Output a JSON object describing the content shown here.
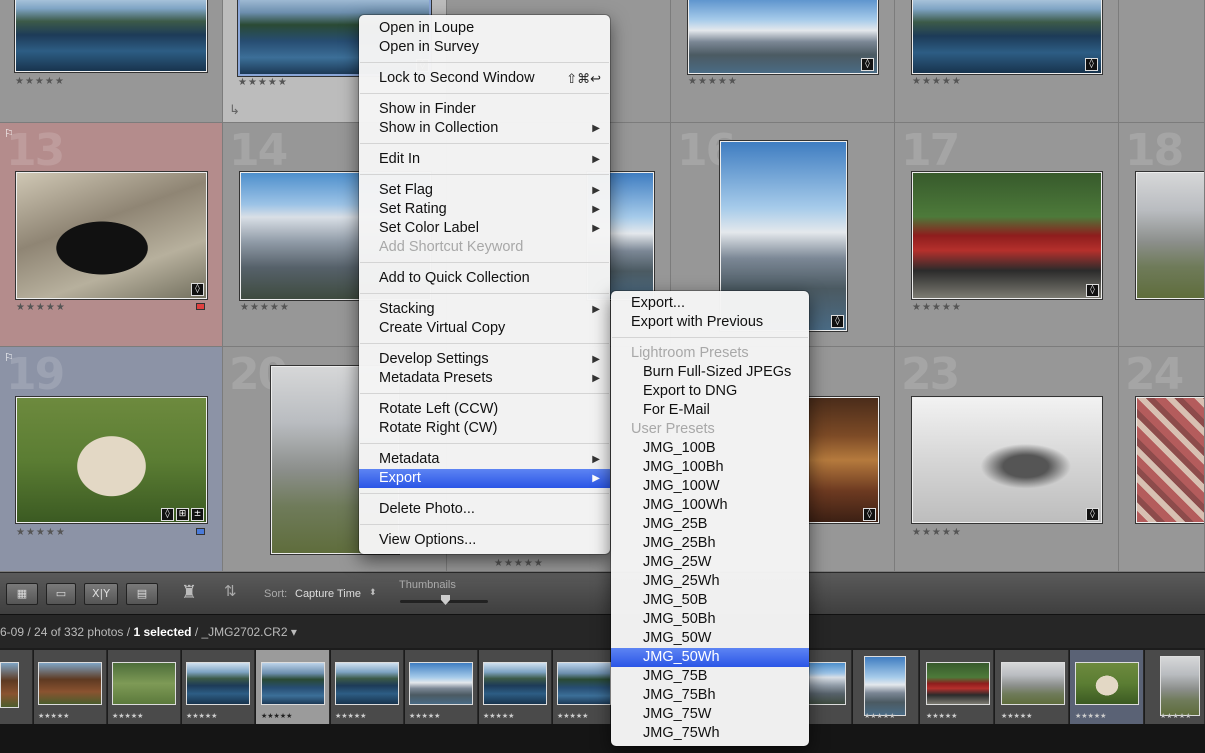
{
  "grid": {
    "cell_numbers": [
      "13",
      "14",
      "16",
      "17",
      "18",
      "19",
      "20",
      "23",
      "24"
    ],
    "stars": "★★★★★",
    "flag_glyph": "⚐"
  },
  "toolbar": {
    "sort_label": "Sort:",
    "sort_value": "Capture Time",
    "thumbnails_label": "Thumbnails",
    "view_xy": "X|Y"
  },
  "filmstrip": {
    "info_prefix": "6-09 / 24 of 332 photos / ",
    "selected": "1 selected",
    "filename": " / _JMG2702.CR2 ▾",
    "stars": "★★★★★"
  },
  "context_menu": {
    "open_in_loupe": "Open in Loupe",
    "open_in_survey": "Open in Survey",
    "lock_to_second_window": "Lock to Second Window",
    "lock_shortcut": "⇧⌘↩",
    "show_in_finder": "Show in Finder",
    "show_in_collection": "Show in Collection",
    "edit_in": "Edit In",
    "set_flag": "Set Flag",
    "set_rating": "Set Rating",
    "set_color_label": "Set Color Label",
    "add_shortcut_keyword": "Add Shortcut Keyword",
    "add_to_quick_collection": "Add to Quick Collection",
    "stacking": "Stacking",
    "create_virtual_copy": "Create Virtual Copy",
    "develop_settings": "Develop Settings",
    "metadata_presets": "Metadata Presets",
    "rotate_left": "Rotate Left (CCW)",
    "rotate_right": "Rotate Right (CW)",
    "metadata": "Metadata",
    "export": "Export",
    "delete_photo": "Delete Photo...",
    "view_options": "View Options...",
    "submenu_arrow": "▶"
  },
  "export_submenu": {
    "export": "Export...",
    "export_with_previous": "Export with Previous",
    "lightroom_presets_header": "Lightroom Presets",
    "lightroom_presets": [
      "Burn Full-Sized JPEGs",
      "Export to DNG",
      "For E-Mail"
    ],
    "user_presets_header": "User Presets",
    "user_presets": [
      "JMG_100B",
      "JMG_100Bh",
      "JMG_100W",
      "JMG_100Wh",
      "JMG_25B",
      "JMG_25Bh",
      "JMG_25W",
      "JMG_25Wh",
      "JMG_50B",
      "JMG_50Bh",
      "JMG_50W",
      "JMG_50Wh",
      "JMG_75B",
      "JMG_75Bh",
      "JMG_75W",
      "JMG_75Wh"
    ],
    "highlighted": "JMG_50Wh"
  }
}
